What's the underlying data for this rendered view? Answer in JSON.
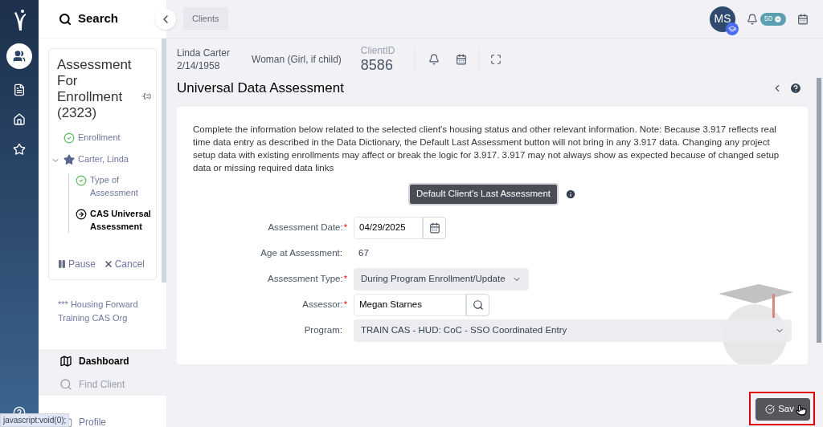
{
  "side_panel": {
    "search_label": "Search",
    "workflow": {
      "title": "Assessment For Enrollment (2323)",
      "steps": [
        {
          "label": "Enrollment",
          "kind": "done"
        },
        {
          "label": "Carter, Linda",
          "kind": "client",
          "expanded": true,
          "children": [
            {
              "label": "Type of Assessment",
              "kind": "done"
            },
            {
              "label": "CAS Universal Assessment",
              "kind": "current"
            }
          ]
        }
      ],
      "actions": [
        {
          "label": "Pause",
          "kind": "pause"
        },
        {
          "label": "Cancel",
          "kind": "cancel"
        }
      ]
    },
    "organization": "*** Housing Forward Training CAS Org",
    "nav": [
      {
        "label": "Dashboard",
        "selected": true
      },
      {
        "label": "Find Client",
        "selected": false
      },
      {
        "label": "Profile",
        "selected": false
      }
    ]
  },
  "rail": [
    {
      "selected": true
    },
    {
      "selected": false
    },
    {
      "selected": false
    },
    {
      "selected": false
    }
  ],
  "breadcrumb": "Clients",
  "user": {
    "initials": "MS",
    "notifications": "50"
  },
  "client": {
    "name": "Linda Carter",
    "dob": "2/14/1958",
    "gender": "Woman (Girl, if child)",
    "id_label": "ClientID",
    "id": "8586"
  },
  "page_title": "Universal Data Assessment",
  "intro": "Complete the information below related to the selected client's housing status and other relevant information. Note: Because 3.917 reflects real time data entry as described in the Data Dictionary, the Default Last Assessment button will not bring in any 3.917 data. Changing any project setup data with existing enrollments may affect or break the logic for 3.917. 3.917 may not always show as expected because of changed setup data or missing required data links",
  "default_button": "Default Client's Last Assessment",
  "fields": [
    {
      "label": "Assessment Date:",
      "required_mark": "*",
      "kind": "date",
      "value": "04/29/2025"
    },
    {
      "label": "Age at Assessment:",
      "kind": "text",
      "value": "67"
    },
    {
      "label": "Assessment Type:",
      "required_mark": "*",
      "kind": "select",
      "value": "During Program Enrollment/Update"
    },
    {
      "label": "Assessor:",
      "required_mark": "*",
      "kind": "lookup",
      "value": "Megan Starnes"
    },
    {
      "label": "Program:",
      "kind": "wide_select",
      "value": "TRAIN CAS - HUD: CoC - SSO Coordinated Entry"
    }
  ],
  "save_button": "Sav",
  "status_url": "javascript:void(0);"
}
